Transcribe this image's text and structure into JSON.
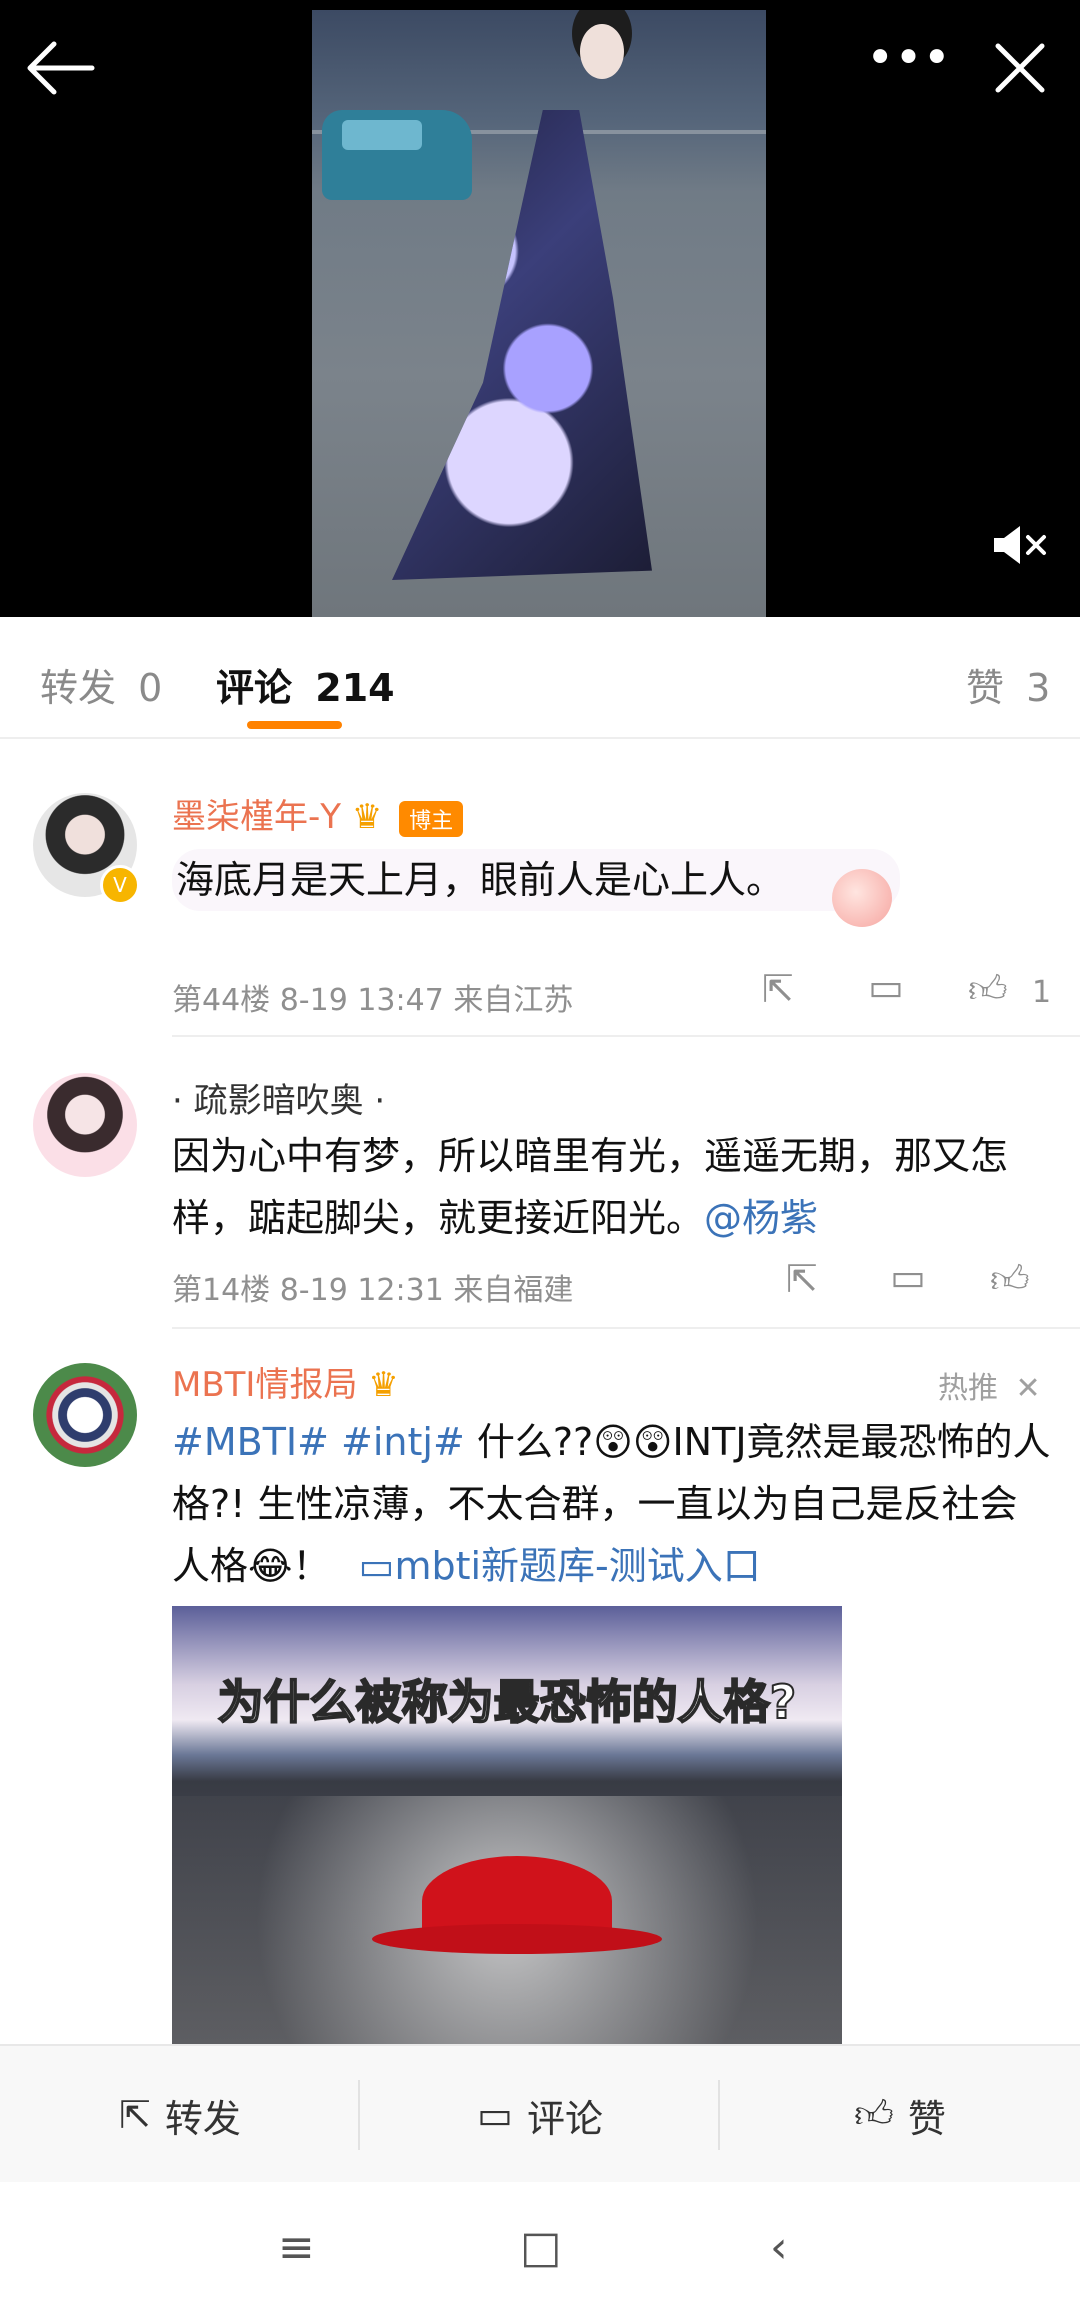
{
  "video": {
    "icons": {
      "back": "arrow-left-icon",
      "more": "more-icon",
      "close": "close-icon",
      "mute": "mute-icon"
    }
  },
  "tabs": [
    {
      "label": "转发",
      "count": "0"
    },
    {
      "label": "评论",
      "count": "214"
    },
    {
      "label": "赞",
      "count": "3"
    }
  ],
  "comments": [
    {
      "name": "墨柒槿年-Y",
      "badge": "博主",
      "text": "海底月是天上月，眼前人是心上人。",
      "meta": "第44楼  8-19 13:47  来自江苏",
      "likes": "1"
    },
    {
      "name": "· 疏影暗吹奥 ·",
      "text": "因为心中有梦，所以暗里有光，遥遥无期，那又怎样，踮起脚尖，就更接近阳光。",
      "mention": "@杨紫",
      "meta": "第14楼  8-19 12:31  来自福建"
    },
    {
      "name": "MBTI情报局",
      "tag": "热推",
      "hashtags": "#MBTI# #intj#",
      "text_part1": " 什么??",
      "text_part2": "INTJ竟然是最恐怖的人格?! 生性凉薄，不太合群，一直以为自己是反社会人格",
      "text_end": "！",
      "link": "mbti新题库-测试入口",
      "media_caption": "为什么被称为最恐怖的人格?"
    }
  ],
  "toolbar": {
    "repost": "转发",
    "comment": "评论",
    "like": "赞"
  },
  "colors": {
    "accent": "#ff8200",
    "name": "#eb7350",
    "link": "#3b73b8"
  }
}
